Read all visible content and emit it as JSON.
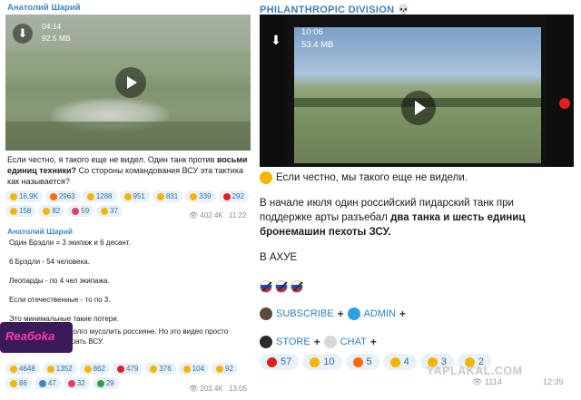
{
  "left_post": {
    "author": "Анатолий Шарий",
    "video": {
      "duration": "04:14",
      "size": "92.5 MB"
    },
    "text_part1": "Если честно, я такого еще не видел.  Один танк против ",
    "text_bold1": "восьми единиц техники?",
    "text_part2": " Со стороны командования ВСУ эта тактика как называется?",
    "reactions": [
      {
        "count": "16.9K",
        "color": "#f5b400",
        "icon": "thumbs-up"
      },
      {
        "count": "2963",
        "color": "#ff6a00",
        "icon": "fire"
      },
      {
        "count": "1288",
        "color": "#f5b400",
        "icon": "angry-face"
      },
      {
        "count": "951",
        "color": "#f5b400",
        "icon": "sad-face"
      },
      {
        "count": "831",
        "color": "#f5b400",
        "icon": "pointing-hand"
      },
      {
        "count": "339",
        "color": "#f5b400",
        "icon": "neutral-face"
      },
      {
        "count": "292",
        "color": "#e02020",
        "icon": "heart"
      },
      {
        "count": "158",
        "color": "#f5b400",
        "icon": "scared-face"
      },
      {
        "count": "82",
        "color": "#f5b400",
        "icon": "praying-hands"
      },
      {
        "count": "59",
        "color": "#e0406a",
        "icon": "heart-eyes"
      },
      {
        "count": "37",
        "color": "#f5b400",
        "icon": "laughing-face"
      }
    ],
    "views": "402.4K",
    "time": "11:22"
  },
  "left_post2": {
    "author": "Анатолий Шарий",
    "lines": [
      "Один Брэдли = 3 экипаж и 6 десант.",
      "6 Брэдли -  54 человека.",
      " Леопарды - по 4 чел экипажа.",
      "Если отечественные - то по 3.",
      "Это минимальные такие потери.",
      "И вот кто и будет долго мусолить россияне. Но это видео просто необходимо разбирать ВСУ."
    ],
    "logo_text": "Reaбoka",
    "reactions": [
      {
        "count": "4648",
        "color": "#f5b400",
        "icon": "thumbs-up"
      },
      {
        "count": "1352",
        "color": "#f5b400",
        "icon": "neutral-face"
      },
      {
        "count": "862",
        "color": "#f5b400",
        "icon": "angry-face"
      },
      {
        "count": "479",
        "color": "#e02020",
        "icon": "heart"
      },
      {
        "count": "376",
        "color": "#f5b400",
        "icon": "party-face"
      },
      {
        "count": "104",
        "color": "#f5b400",
        "icon": "pointing-hand"
      },
      {
        "count": "92",
        "color": "#f5b400",
        "icon": "thumbs-up"
      },
      {
        "count": "86",
        "color": "#f5b400",
        "icon": "clapping-hands"
      },
      {
        "count": "47",
        "color": "#3a87c8",
        "icon": "hundred"
      },
      {
        "count": "32",
        "color": "#e0406a",
        "icon": "heart-eyes"
      },
      {
        "count": "29",
        "color": "#2ea043",
        "icon": "tree"
      }
    ],
    "views": "203.4K",
    "time": "13:05"
  },
  "right_post": {
    "channel": "PHILANTHROPIC DIVISION 💀",
    "video": {
      "duration": "10:06",
      "size": "53.4 MB"
    },
    "lead": "Если честно, мы такого еще не видели.",
    "para_part1": "В начале июля один российский пидарский танк при поддержке арты разъебал ",
    "para_bold": "два танка и шесть единиц бронемашин пехоты ЗСУ.",
    "outro": "В АХУЕ",
    "links_row1": {
      "subscribe": "SUBSCRIBE",
      "admin": "ADMIN",
      "plus": "+"
    },
    "links_row2": {
      "store": "STORE",
      "chat": "CHAT",
      "plus": "+"
    },
    "reactions": [
      {
        "count": "57",
        "color": "#e02020",
        "icon": "angry-red-face"
      },
      {
        "count": "10",
        "color": "#f5b400",
        "icon": "sad-face"
      },
      {
        "count": "5",
        "color": "#ff6a00",
        "icon": "fire"
      },
      {
        "count": "4",
        "color": "#f5b400",
        "icon": "heart-eyes-face"
      },
      {
        "count": "3",
        "color": "#f5b400",
        "icon": "thumbs-up"
      },
      {
        "count": "2",
        "color": "#f5b400",
        "icon": "thumbs-down"
      }
    ],
    "watermark": "YAPLAKAL.COM",
    "views": "1114",
    "time": "12:39"
  }
}
